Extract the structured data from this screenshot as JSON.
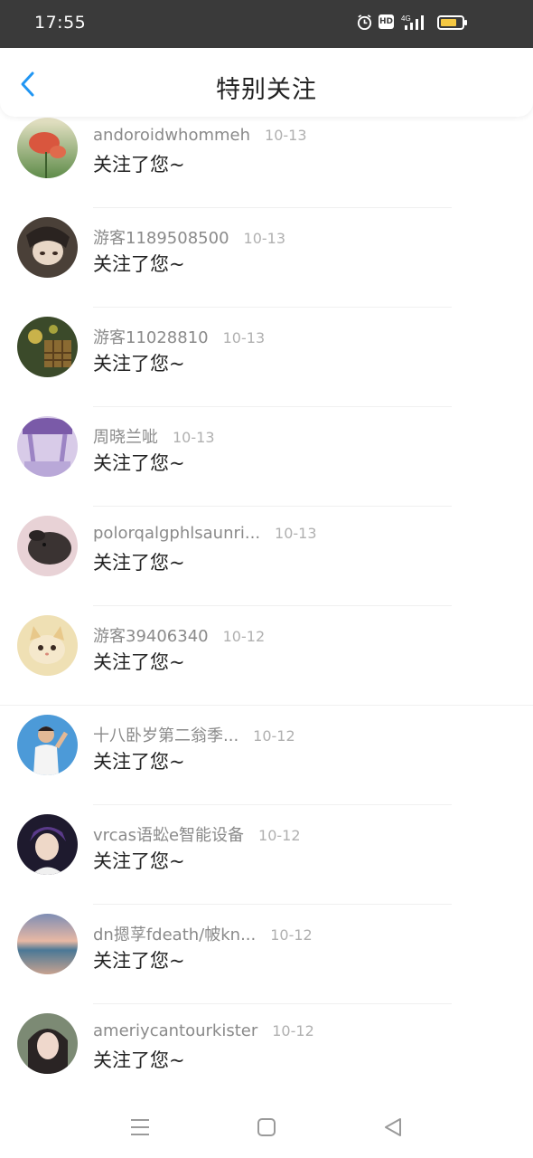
{
  "status_bar": {
    "time": "17:55",
    "icons": [
      "alarm-icon",
      "hd-icon",
      "4g-signal-icon",
      "battery-icon"
    ],
    "hd_label": "HD",
    "net_label": "4G"
  },
  "header": {
    "title": "特别关注",
    "back_icon": "chevron-left-icon",
    "accent_color": "#2196f3"
  },
  "items": [
    {
      "name": "andoroidwhommeh",
      "date": "10-13",
      "message": "关注了您~"
    },
    {
      "name": "游客1189508500",
      "date": "10-13",
      "message": "关注了您~"
    },
    {
      "name": "游客11028810",
      "date": "10-13",
      "message": "关注了您~"
    },
    {
      "name": "周晓兰呲",
      "date": "10-13",
      "message": "关注了您~"
    },
    {
      "name": "polorqalgphlsaunri...",
      "date": "10-13",
      "message": "关注了您~"
    },
    {
      "name": "游客39406340",
      "date": "10-12",
      "message": "关注了您~"
    },
    {
      "name": "十八卧岁第二翁季...",
      "date": "10-12",
      "message": "关注了您~"
    },
    {
      "name": "vrcas语蚣e智能设备",
      "date": "10-12",
      "message": "关注了您~"
    },
    {
      "name": "dn摁莩fdeath/帔kn...",
      "date": "10-12",
      "message": "关注了您~"
    },
    {
      "name": "ameriycantourkister",
      "date": "10-12",
      "message": "关注了您~"
    }
  ],
  "nav_bar": {
    "buttons": [
      "menu-icon",
      "home-square-icon",
      "back-triangle-icon"
    ]
  }
}
